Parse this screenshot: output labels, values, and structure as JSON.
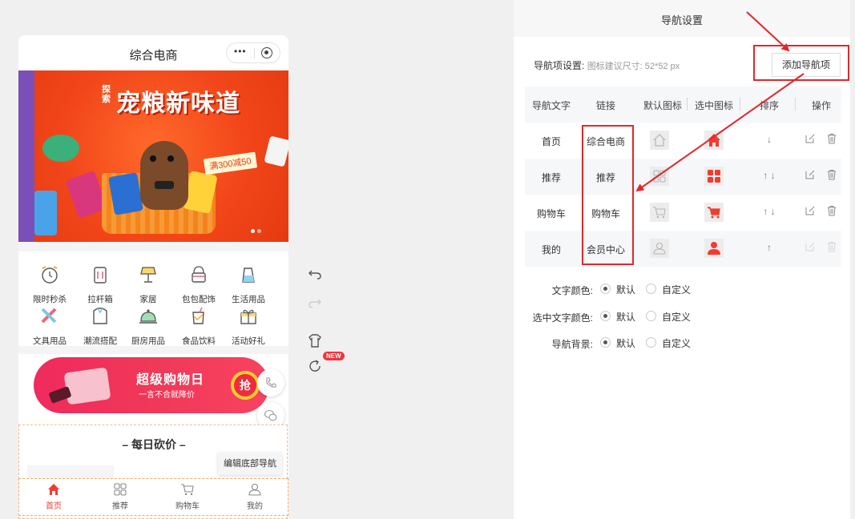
{
  "phone": {
    "title": "综合电商",
    "banner": {
      "tag": "探索",
      "title": "宠粮新味道",
      "subtitle": "满300减50"
    },
    "categories": [
      {
        "label": "限时秒杀",
        "icon": "alarm-clock-icon"
      },
      {
        "label": "拉杆箱",
        "icon": "suitcase-icon"
      },
      {
        "label": "家居",
        "icon": "lamp-icon"
      },
      {
        "label": "包包配饰",
        "icon": "handbag-icon"
      },
      {
        "label": "生活用品",
        "icon": "kettle-icon"
      },
      {
        "label": "文具用品",
        "icon": "stationery-icon"
      },
      {
        "label": "潮流搭配",
        "icon": "shirt-icon"
      },
      {
        "label": "厨房用品",
        "icon": "cloche-icon"
      },
      {
        "label": "食品饮料",
        "icon": "drink-icon"
      },
      {
        "label": "活动好礼",
        "icon": "gift-icon"
      }
    ],
    "promo": {
      "title": "超级购物日",
      "subtitle": "一言不合就降价",
      "grab": "抢"
    },
    "daily": {
      "title": "– 每日砍价 –"
    },
    "tooltip": "编辑底部导航",
    "tabbar": [
      {
        "label": "首页",
        "icon": "home-icon",
        "active": true
      },
      {
        "label": "推荐",
        "icon": "grid-icon",
        "active": false
      },
      {
        "label": "购物车",
        "icon": "cart-icon",
        "active": false
      },
      {
        "label": "我的",
        "icon": "user-icon",
        "active": false
      }
    ]
  },
  "tools": {
    "badge": "NEW"
  },
  "panel": {
    "title": "导航设置",
    "nav_label": "导航项设置:",
    "nav_hint": "图标建议尺寸: 52*52 px",
    "add_button": "添加导航项",
    "table": {
      "headers": [
        "导航文字",
        "链接",
        "默认图标",
        "选中图标",
        "排序",
        "操作"
      ],
      "rows": [
        {
          "text": "首页",
          "link": "综合电商",
          "icon": "home-icon",
          "sort": "↓"
        },
        {
          "text": "推荐",
          "link": "推荐",
          "icon": "grid-icon",
          "sort": "↑ ↓"
        },
        {
          "text": "购物车",
          "link": "购物车",
          "icon": "cart-icon",
          "sort": "↑ ↓"
        },
        {
          "text": "我的",
          "link": "会员中心",
          "icon": "user-icon",
          "sort": "↑"
        }
      ]
    },
    "options": [
      {
        "label": "文字颜色:",
        "choices": [
          "默认",
          "自定义"
        ],
        "selected": "默认"
      },
      {
        "label": "选中文字颜色:",
        "choices": [
          "默认",
          "自定义"
        ],
        "selected": "默认"
      },
      {
        "label": "导航背景:",
        "choices": [
          "默认",
          "自定义"
        ],
        "selected": "默认"
      }
    ]
  },
  "colors": {
    "accent_red": "#f53a2f",
    "highlight_red": "#e3262c",
    "promo_pink": "#f02a5e"
  }
}
